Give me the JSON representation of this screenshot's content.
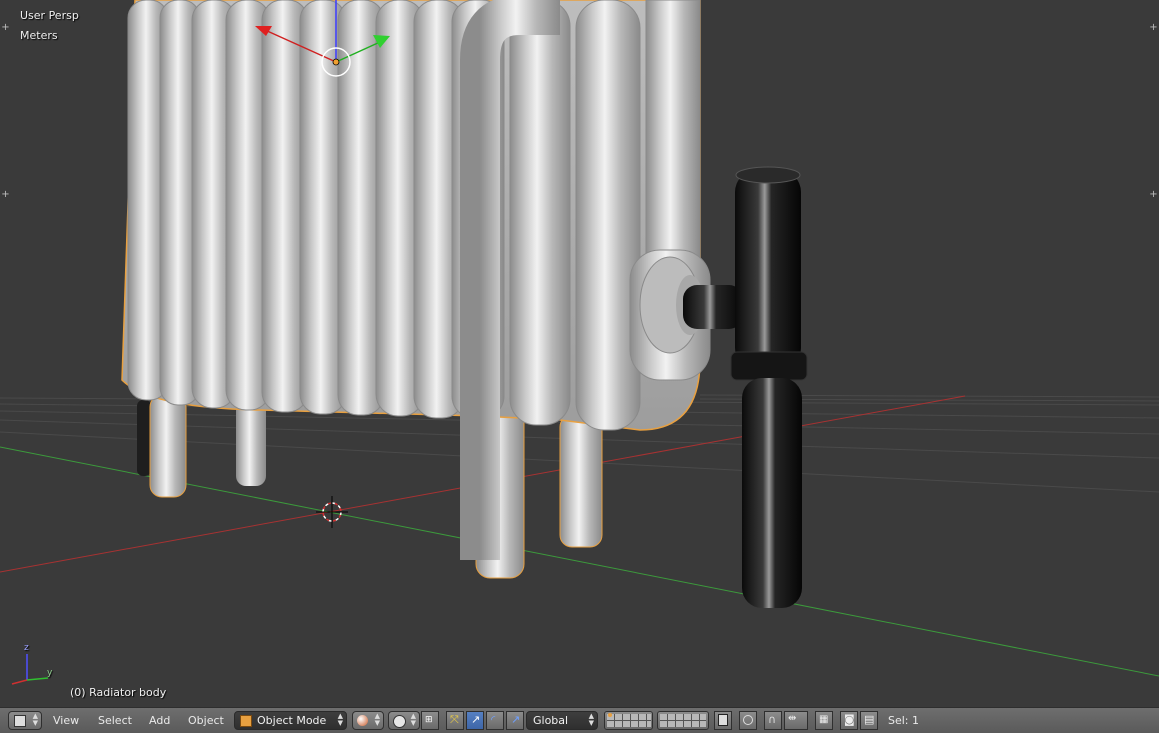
{
  "viewport": {
    "view_name": "User Persp",
    "units": "Meters",
    "object_info": "(0) Radiator body",
    "axis_labels": {
      "z": "z",
      "y": "y"
    }
  },
  "header": {
    "editor_type_icon": "3d-view-cube-icon",
    "menus": [
      "View",
      "Select",
      "Add",
      "Object"
    ],
    "mode": {
      "label": "Object Mode",
      "icon": "object-mode-cube-icon"
    },
    "shading_icon": "solid-shading-sphere-icon",
    "pivot_icon": "pivot-point-icon",
    "manipulator_icons": [
      "manipulator-toggle-icon",
      "translate-icon",
      "rotate-icon",
      "scale-icon"
    ],
    "orientation": "Global",
    "layers_icon": "layer-grid-icon",
    "right_icons": [
      "lock-camera-icon",
      "proportional-edit-icon",
      "snap-magnet-icon",
      "snap-element-icon",
      "snap-target-icon",
      "render-camera-icon",
      "render-animation-icon"
    ],
    "status": "Sel: 1"
  },
  "colors": {
    "viewport_bg": "#3a3a3a",
    "header_bg": "#666666",
    "selection_outline": "#f0a030",
    "x_axis": "#b03434",
    "y_axis": "#3d9f3d",
    "active_button": "#5680c2"
  }
}
